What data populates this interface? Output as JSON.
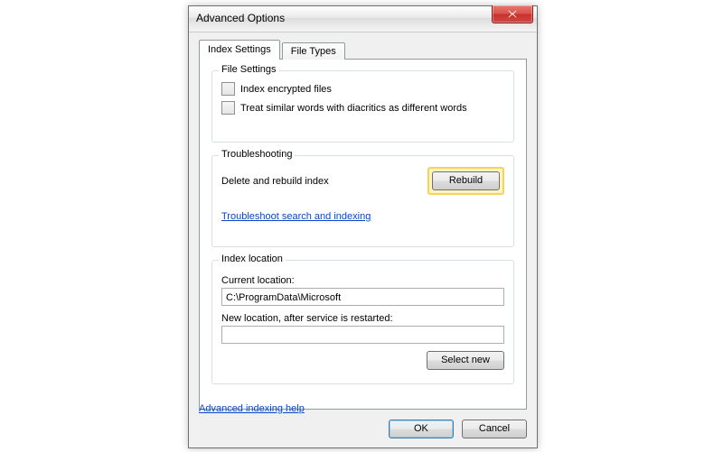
{
  "window": {
    "title": "Advanced Options"
  },
  "tabs": {
    "index_settings": "Index Settings",
    "file_types": "File Types"
  },
  "file_settings": {
    "legend": "File Settings",
    "opt_encrypted": "Index encrypted files",
    "opt_diacritics": "Treat similar words with diacritics as different words"
  },
  "troubleshooting": {
    "legend": "Troubleshooting",
    "delete_rebuild": "Delete and rebuild index",
    "rebuild_btn": "Rebuild",
    "link": "Troubleshoot search and indexing"
  },
  "index_location": {
    "legend": "Index location",
    "current_label": "Current location:",
    "current_value": "C:\\ProgramData\\Microsoft",
    "new_label": "New location, after service is restarted:",
    "new_value": "",
    "select_new_btn": "Select new"
  },
  "footer": {
    "help_link": "Advanced indexing help",
    "ok": "OK",
    "cancel": "Cancel"
  }
}
